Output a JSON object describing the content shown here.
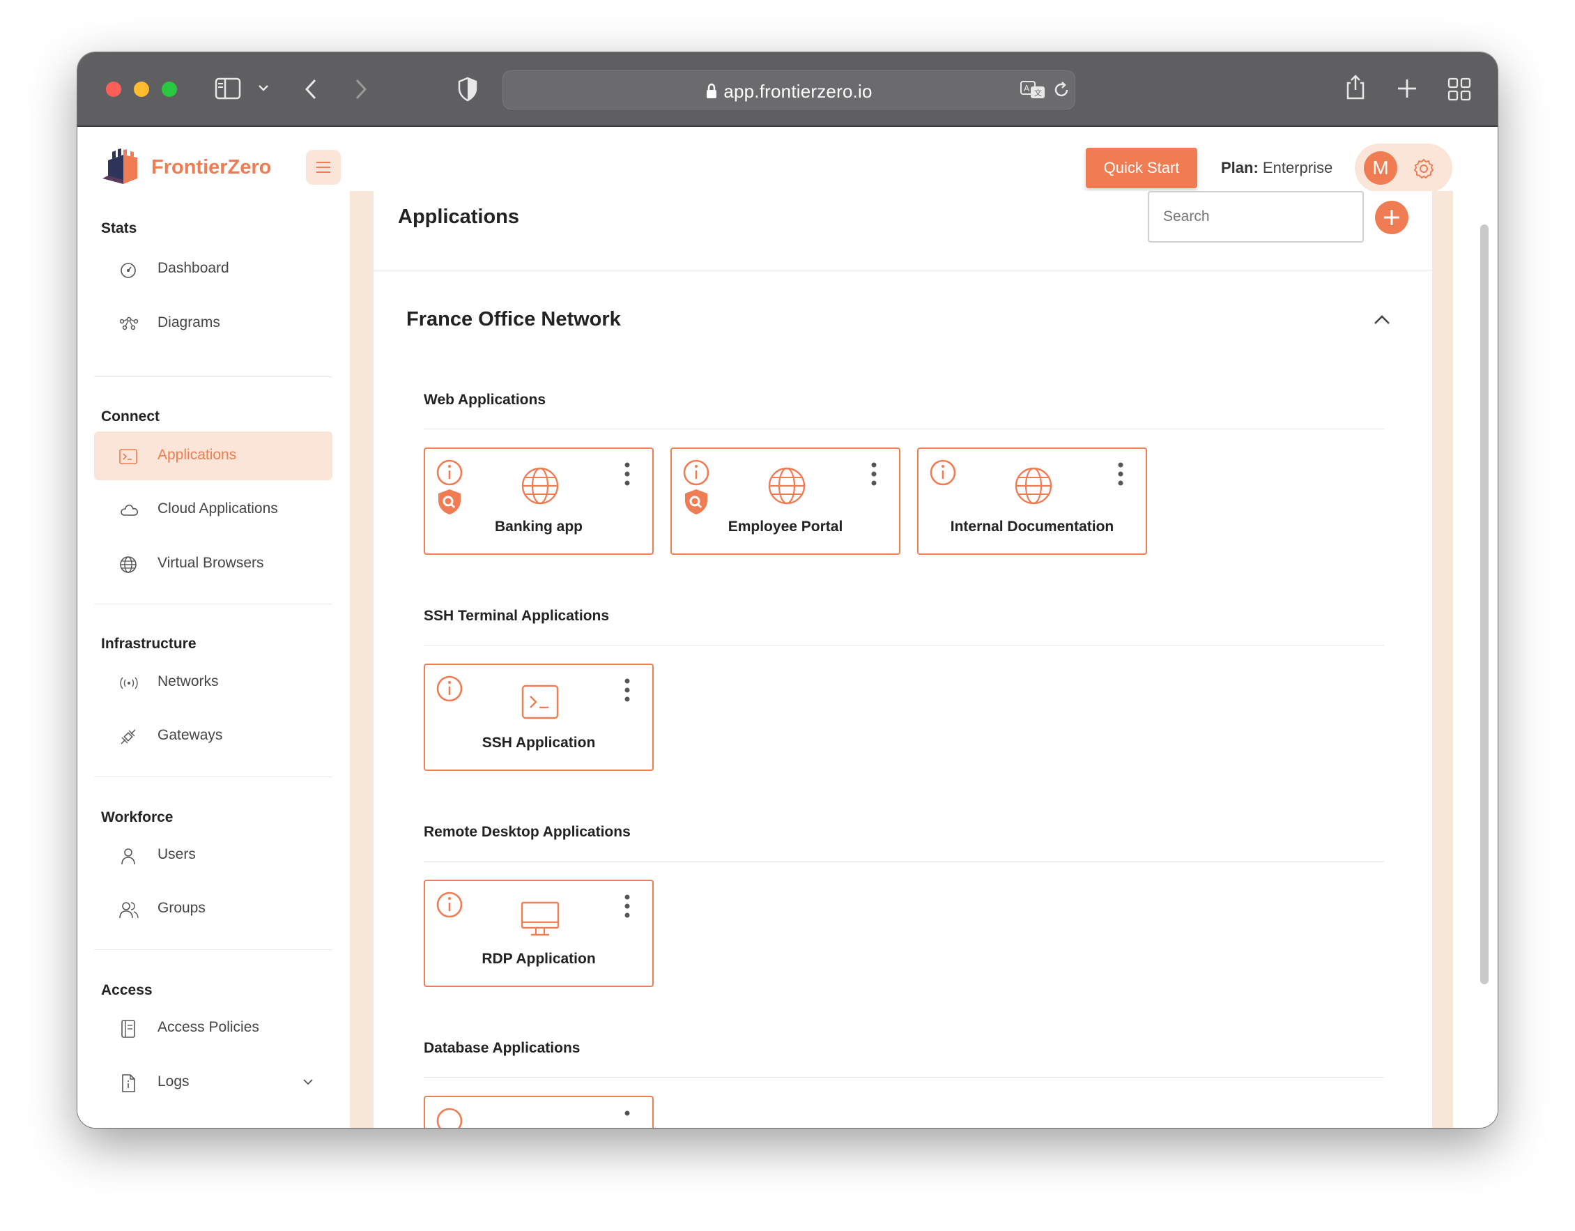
{
  "browser": {
    "url": "app.frontierzero.io"
  },
  "header": {
    "brand": "FrontierZero",
    "quick_start": "Quick Start",
    "plan_label": "Plan:",
    "plan_value": "Enterprise",
    "avatar_initial": "M"
  },
  "sidebar": {
    "sections": [
      {
        "title": "Stats",
        "items": [
          {
            "label": "Dashboard",
            "icon": "dashboard-icon"
          },
          {
            "label": "Diagrams",
            "icon": "diagram-icon"
          }
        ]
      },
      {
        "title": "Connect",
        "items": [
          {
            "label": "Applications",
            "icon": "terminal-icon",
            "active": true
          },
          {
            "label": "Cloud Applications",
            "icon": "cloud-icon"
          },
          {
            "label": "Virtual Browsers",
            "icon": "globe-icon"
          }
        ]
      },
      {
        "title": "Infrastructure",
        "items": [
          {
            "label": "Networks",
            "icon": "broadcast-icon"
          },
          {
            "label": "Gateways",
            "icon": "satellite-icon"
          }
        ]
      },
      {
        "title": "Workforce",
        "items": [
          {
            "label": "Users",
            "icon": "user-icon"
          },
          {
            "label": "Groups",
            "icon": "users-icon"
          }
        ]
      },
      {
        "title": "Access",
        "items": [
          {
            "label": "Access Policies",
            "icon": "policy-icon"
          },
          {
            "label": "Logs",
            "icon": "file-icon"
          }
        ]
      }
    ]
  },
  "main": {
    "title": "Applications",
    "search_placeholder": "Search",
    "network": {
      "name": "France Office Network",
      "categories": [
        {
          "title": "Web Applications",
          "apps": [
            {
              "name": "Banking app",
              "icon": "globe-icon",
              "inspected": true
            },
            {
              "name": "Employee Portal",
              "icon": "globe-icon",
              "inspected": true
            },
            {
              "name": "Internal Documentation",
              "icon": "globe-icon",
              "inspected": false
            }
          ]
        },
        {
          "title": "SSH Terminal Applications",
          "apps": [
            {
              "name": "SSH Application",
              "icon": "terminal-icon",
              "inspected": false
            }
          ]
        },
        {
          "title": "Remote Desktop Applications",
          "apps": [
            {
              "name": "RDP Application",
              "icon": "monitor-icon",
              "inspected": false
            }
          ]
        },
        {
          "title": "Database Applications",
          "apps": []
        }
      ]
    }
  },
  "colors": {
    "accent": "#ef7c52",
    "accent_light": "#fbe5d8",
    "panel_border": "#f7e7d8",
    "titlebar": "#5f5f61"
  }
}
